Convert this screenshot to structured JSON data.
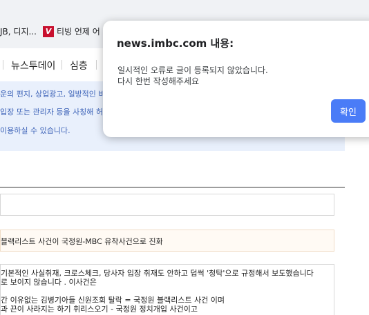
{
  "bookmarks": {
    "item1": "JB, 디지...",
    "item2_logo": "V",
    "item2": "티빙 언제 어"
  },
  "site_nav": {
    "items": [
      "뉴스투데이",
      "심층"
    ]
  },
  "notice": {
    "lines": [
      "운의 편지, 상업광고, 일방적인 비방",
      "입장 또는 관리자 등을 사칭해 허위",
      "이용하실 수 있습니다."
    ]
  },
  "form": {
    "title_value": "블랙리스트 사건이 국정원-MBC 유착사건으로 진화",
    "body_lines": [
      "기본적인 사실취재, 크로스체크, 당사자 입장 취재도 안하고 덥썩 '청탁'으로 규정해서 보도했습니다",
      "로 보이지 않습니다 . 이사건은",
      "",
      "간 이유없는 김병기아들 신원조회 탈락 = 국정원 블랙리스트 사건 이며",
      "과 끈이 사라지는 하기 휘리스오기 - 국정원 정치개입 사건이고"
    ]
  },
  "dialog": {
    "title": "news.imbc.com 내용:",
    "message_line1": "일시적인 오류로 글이 등록되지 않았습니다.",
    "message_line2": "다시 한번 작성해주세요",
    "ok_label": "확인"
  }
}
